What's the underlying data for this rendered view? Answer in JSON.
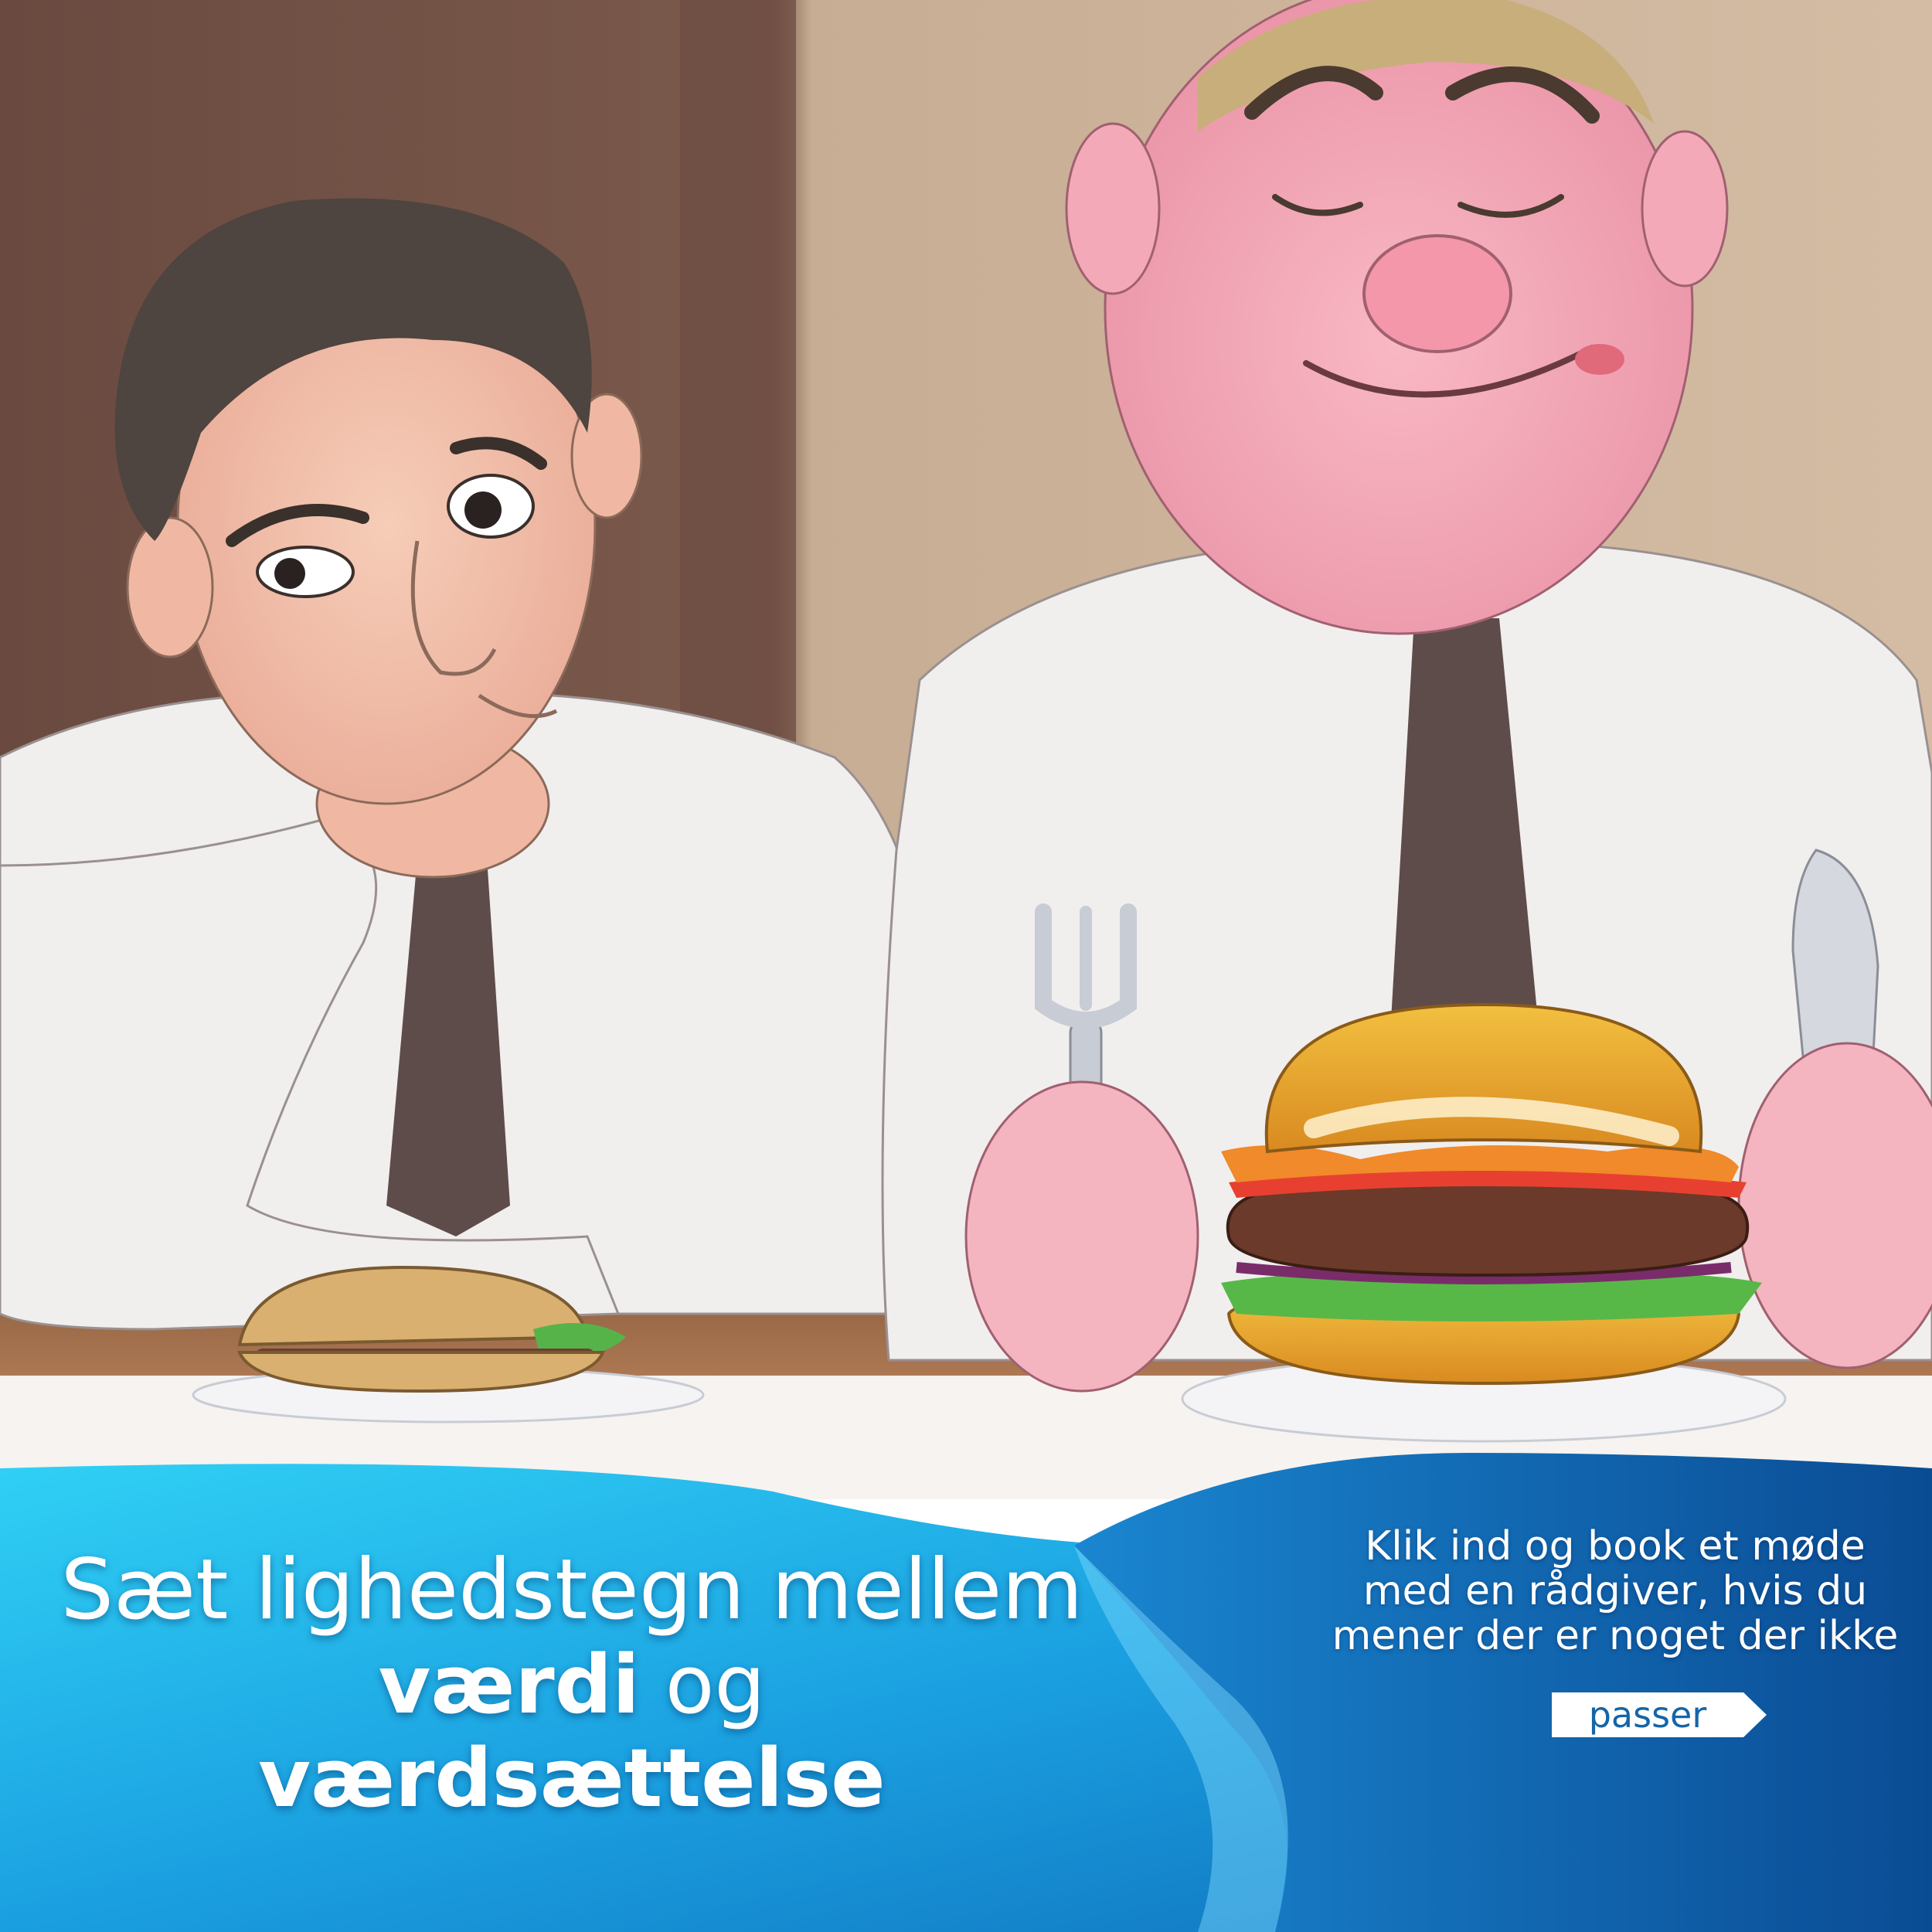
{
  "headline": {
    "line1": "Sæt lighedstegn mellem",
    "line2_bold": "værdi",
    "line2_rest": " og",
    "line3": "værdsættelse"
  },
  "cta": {
    "text_lines": [
      "Klik ind og book et møde",
      "med en rådgiver, hvis du",
      "mener der er noget der ikke"
    ],
    "button_label": "passer"
  },
  "colors": {
    "wave_light": "#32c4f0",
    "wave_dark": "#0e5ea8",
    "background_wall": "#c9ad92",
    "shirt": "#f2eeee",
    "tie": "#5a4a48",
    "skin_thin": "#f2c2ae",
    "skin_fat": "#f6a6b6"
  },
  "icons": {
    "arrow": "chevron-right-icon",
    "fork": "fork-icon",
    "knife": "knife-icon"
  }
}
